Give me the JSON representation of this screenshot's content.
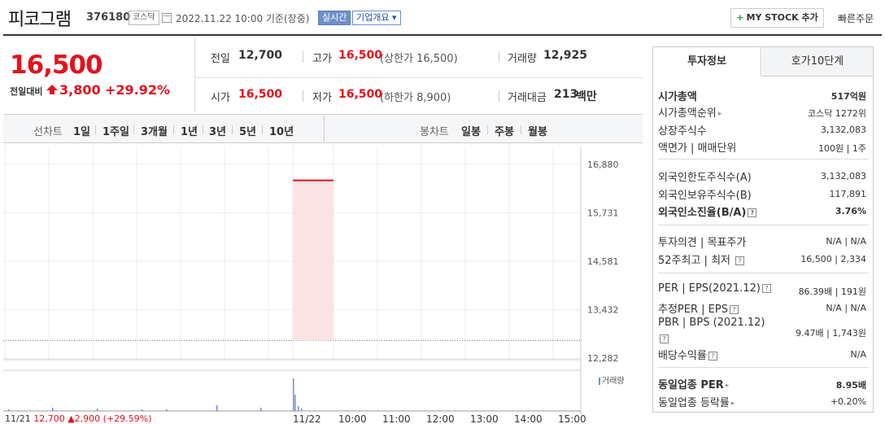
{
  "header": {
    "stock_name": "피코그램",
    "stock_code": "376180",
    "market_tag": "코스닥",
    "datetime": "2022.11.22 10:00  기준(장중)",
    "live_tag": "실시간",
    "company_tag": "기업개요 ▾",
    "mystock_label": "MY STOCK 추가",
    "quick_order_label": "빠른주문"
  },
  "price": {
    "current": "16,500",
    "change_label": "전일대비",
    "change_value": "3,800",
    "change_pct": "+29.92%"
  },
  "summary": {
    "prev_label": "전일",
    "prev_value": "12,700",
    "high_label": "고가",
    "high_value": "16,500",
    "upper_limit": "(상한가 16,500)",
    "volume_label": "거래량",
    "volume_value": "12,925",
    "open_label": "시가",
    "open_value": "16,500",
    "low_label": "저가",
    "low_value": "16,500",
    "lower_limit": "(하한가 8,900)",
    "amount_label": "거래대금",
    "amount_value": "213",
    "amount_unit": "백만"
  },
  "chart_tabs": {
    "line_label": "선차트",
    "line_items": [
      "1일",
      "1주일",
      "3개월",
      "1년",
      "3년",
      "5년",
      "10년"
    ],
    "candle_label": "봉차트",
    "candle_items": [
      "일봉",
      "주봉",
      "월봉"
    ]
  },
  "chart_data": {
    "type": "line",
    "y_ticks": [
      "16,880",
      "15,731",
      "14,581",
      "13,432",
      "12,282"
    ],
    "x_ticks": [
      "11/22",
      "10:00",
      "11:00",
      "12:00",
      "13:00",
      "14:00",
      "15:00"
    ],
    "prev_close": 12700,
    "current": 16500,
    "volume_label": "거래량",
    "footer": {
      "date": "11/21",
      "close": "12,700",
      "change": "2,900",
      "pct": "(+29.59%)"
    }
  },
  "panel": {
    "tab_info": "투자정보",
    "tab_orderbook": "호가10단계",
    "rows": {
      "market_cap_label": "시가총액",
      "market_cap_value": "517억원",
      "cap_rank_label": "시가총액순위",
      "cap_rank_value": "코스닥 1272위",
      "shares_label": "상장주식수",
      "shares_value": "3,132,083",
      "par_label": "액면가 | 매매단위",
      "par_value": "100원 | 1주",
      "foreign_limit_label": "외국인한도주식수(A)",
      "foreign_limit_value": "3,132,083",
      "foreign_hold_label": "외국인보유주식수(B)",
      "foreign_hold_value": "117,891",
      "foreign_ratio_label": "외국인소진율(B/A)",
      "foreign_ratio_value": "3.76%",
      "opinion_label": "투자의견 | 목표주가",
      "opinion_value": "N/A | N/A",
      "week52_label": "52주최고 | 최저",
      "week52_value": "16,500 | 2,334",
      "per_label": "PER | EPS(2021.12)",
      "per_value": "86.39배 | 191원",
      "est_per_label": "추정PER | EPS",
      "est_per_value": "N/A | N/A",
      "pbr_label": "PBR | BPS (2021.12)",
      "pbr_value": "9.47배 | 1,743원",
      "dividend_label": "배당수익률",
      "dividend_value": "N/A",
      "sector_per_label": "동일업종 PER",
      "sector_per_value": "8.95배",
      "sector_rate_label": "동일업종 등락률",
      "sector_rate_value": "+0.20%"
    }
  }
}
